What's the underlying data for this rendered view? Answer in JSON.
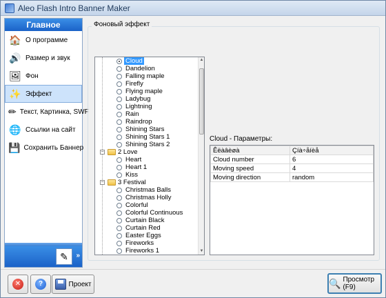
{
  "window": {
    "title": "Aleo Flash Intro Banner Maker"
  },
  "sidebar": {
    "header": "Главное",
    "items": [
      {
        "label": "О программе",
        "icon": "home-icon",
        "glyph": "🏠",
        "active": false
      },
      {
        "label": "Размер и звук",
        "icon": "speaker-icon",
        "glyph": "🔊",
        "active": false
      },
      {
        "label": "Фон",
        "icon": "picture-icon",
        "glyph": "🖼",
        "active": false
      },
      {
        "label": "Эффект",
        "icon": "effect-sparkle-icon",
        "glyph": "✨",
        "active": true
      },
      {
        "label": "Текст, Картинка, SWF",
        "icon": "text-pencil-icon",
        "glyph": "✏",
        "active": false
      },
      {
        "label": "Ссылки на сайт",
        "icon": "globe-icon",
        "glyph": "🌐",
        "active": false
      },
      {
        "label": "Сохранить Баннер",
        "icon": "save-banner-icon",
        "glyph": "💾",
        "active": false
      }
    ],
    "more_glyph": "»"
  },
  "main": {
    "group_title": "Фоновый эффект",
    "tree": {
      "rows": [
        {
          "type": "item",
          "label": "Cloud",
          "checked": true,
          "selected": true
        },
        {
          "type": "item",
          "label": "Dandelion"
        },
        {
          "type": "item",
          "label": "Falling maple"
        },
        {
          "type": "item",
          "label": "Firefly"
        },
        {
          "type": "item",
          "label": "Flying maple"
        },
        {
          "type": "item",
          "label": "Ladybug"
        },
        {
          "type": "item",
          "label": "Lightning"
        },
        {
          "type": "item",
          "label": "Rain"
        },
        {
          "type": "item",
          "label": "Raindrop"
        },
        {
          "type": "item",
          "label": "Shining Stars"
        },
        {
          "type": "item",
          "label": "Shining Stars 1"
        },
        {
          "type": "item",
          "label": "Shining Stars 2"
        },
        {
          "type": "category",
          "label": "2 Love"
        },
        {
          "type": "item",
          "label": "Heart"
        },
        {
          "type": "item",
          "label": "Heart 1"
        },
        {
          "type": "item",
          "label": "Kiss"
        },
        {
          "type": "category",
          "label": "3 Festival"
        },
        {
          "type": "item",
          "label": "Christmas Balls"
        },
        {
          "type": "item",
          "label": "Christmas Holly"
        },
        {
          "type": "item",
          "label": "Colorful"
        },
        {
          "type": "item",
          "label": "Colorful Continuous"
        },
        {
          "type": "item",
          "label": "Curtain Black"
        },
        {
          "type": "item",
          "label": "Curtain Red"
        },
        {
          "type": "item",
          "label": "Easter Eggs"
        },
        {
          "type": "item",
          "label": "Fireworks"
        },
        {
          "type": "item",
          "label": "Fireworks 1"
        }
      ],
      "expander_glyph": "−"
    },
    "params": {
      "title": "Cloud - Параметры:",
      "headers": [
        "Êëàâèøà",
        "Çíà÷åíèå"
      ],
      "rows": [
        [
          "Cloud number",
          "6"
        ],
        [
          "Moving speed",
          "4"
        ],
        [
          "Moving direction",
          "random"
        ]
      ]
    }
  },
  "bottom": {
    "close_glyph": "✕",
    "help_glyph": "?",
    "project_label": "Проект",
    "preview_label": "Просмотр (F9)",
    "preview_glyph": "🔍"
  }
}
